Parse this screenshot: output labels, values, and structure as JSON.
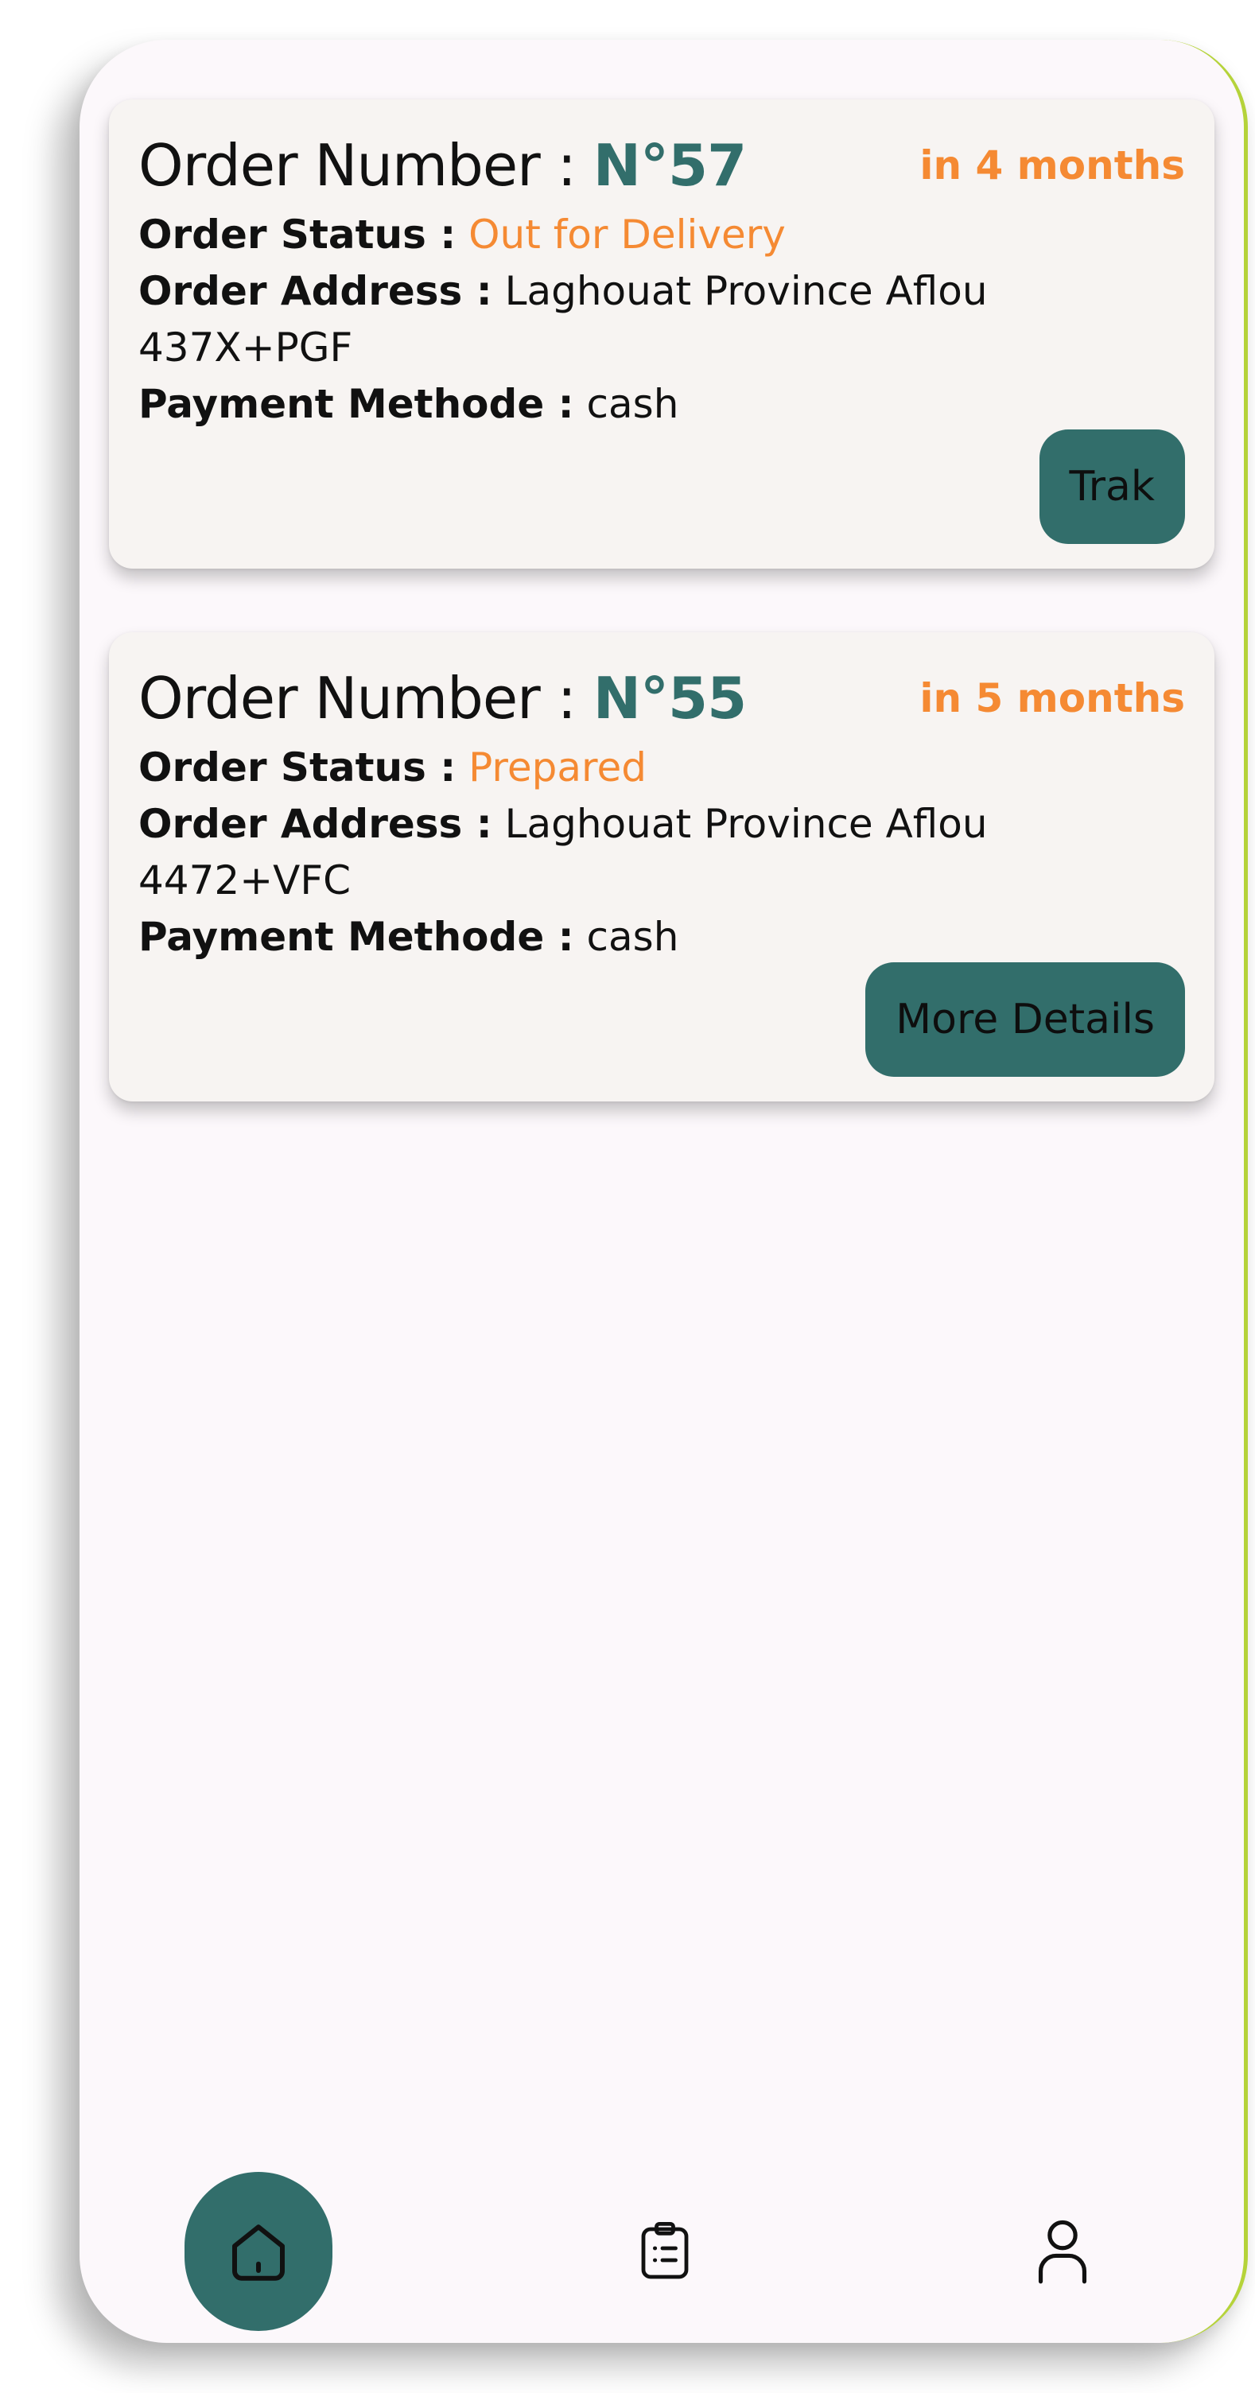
{
  "orders": [
    {
      "title_label": "Order Number :",
      "number": "N°57",
      "time": "in 4 months",
      "status_label": "Order Status :",
      "status": "Out for Delivery",
      "address_label": "Order Address :",
      "address": "Laghouat Province Aflou 437X+PGF",
      "payment_label": "Payment Methode :",
      "payment": "cash",
      "button_label": "Trak"
    },
    {
      "title_label": "Order Number :",
      "number": "N°55",
      "time": "in 5 months",
      "status_label": "Order Status :",
      "status": "Prepared",
      "address_label": "Order Address :",
      "address": "Laghouat Province Aflou 4472+VFC",
      "payment_label": "Payment Methode :",
      "payment": "cash",
      "button_label": "More Details"
    }
  ],
  "bottom_nav": {
    "items": [
      {
        "icon": "home-icon",
        "active": true
      },
      {
        "icon": "clipboard-list-icon",
        "active": false
      },
      {
        "icon": "user-icon",
        "active": false
      }
    ]
  },
  "colors": {
    "accent_teal": "#326e6b",
    "accent_orange": "#f58a33",
    "card_bg": "#f7f4f2",
    "screen_bg": "#fcf8fb"
  }
}
